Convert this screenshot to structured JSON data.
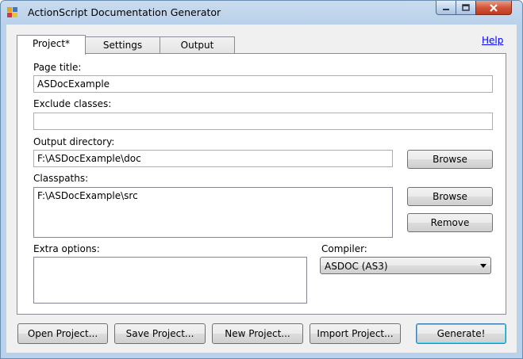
{
  "window": {
    "title": "ActionScript Documentation Generator"
  },
  "tabs": [
    {
      "label": "Project*",
      "active": true
    },
    {
      "label": "Settings",
      "active": false
    },
    {
      "label": "Output",
      "active": false
    }
  ],
  "help_link": "Help",
  "form": {
    "page_title_label": "Page title:",
    "page_title_value": "ASDocExample",
    "exclude_label": "Exclude classes:",
    "exclude_value": "",
    "output_label": "Output directory:",
    "output_value": "F:\\ASDocExample\\doc",
    "classpaths_label": "Classpaths:",
    "classpaths_value": "F:\\ASDocExample\\src",
    "extra_label": "Extra options:",
    "extra_value": "",
    "compiler_label": "Compiler:",
    "compiler_value": "ASDOC (AS3)",
    "browse_output": "Browse",
    "browse_classpath": "Browse",
    "remove_classpath": "Remove"
  },
  "bottom_buttons": {
    "open": "Open Project...",
    "save": "Save Project...",
    "new": "New Project...",
    "import": "Import Project...",
    "generate": "Generate!"
  },
  "colors": {
    "link": "#0000ff",
    "titlebar": "#b9d1ea",
    "close_button": "#c0391f"
  },
  "icons": [
    "app-icon",
    "minimize-icon",
    "maximize-icon",
    "close-icon",
    "dropdown-arrow-icon"
  ]
}
